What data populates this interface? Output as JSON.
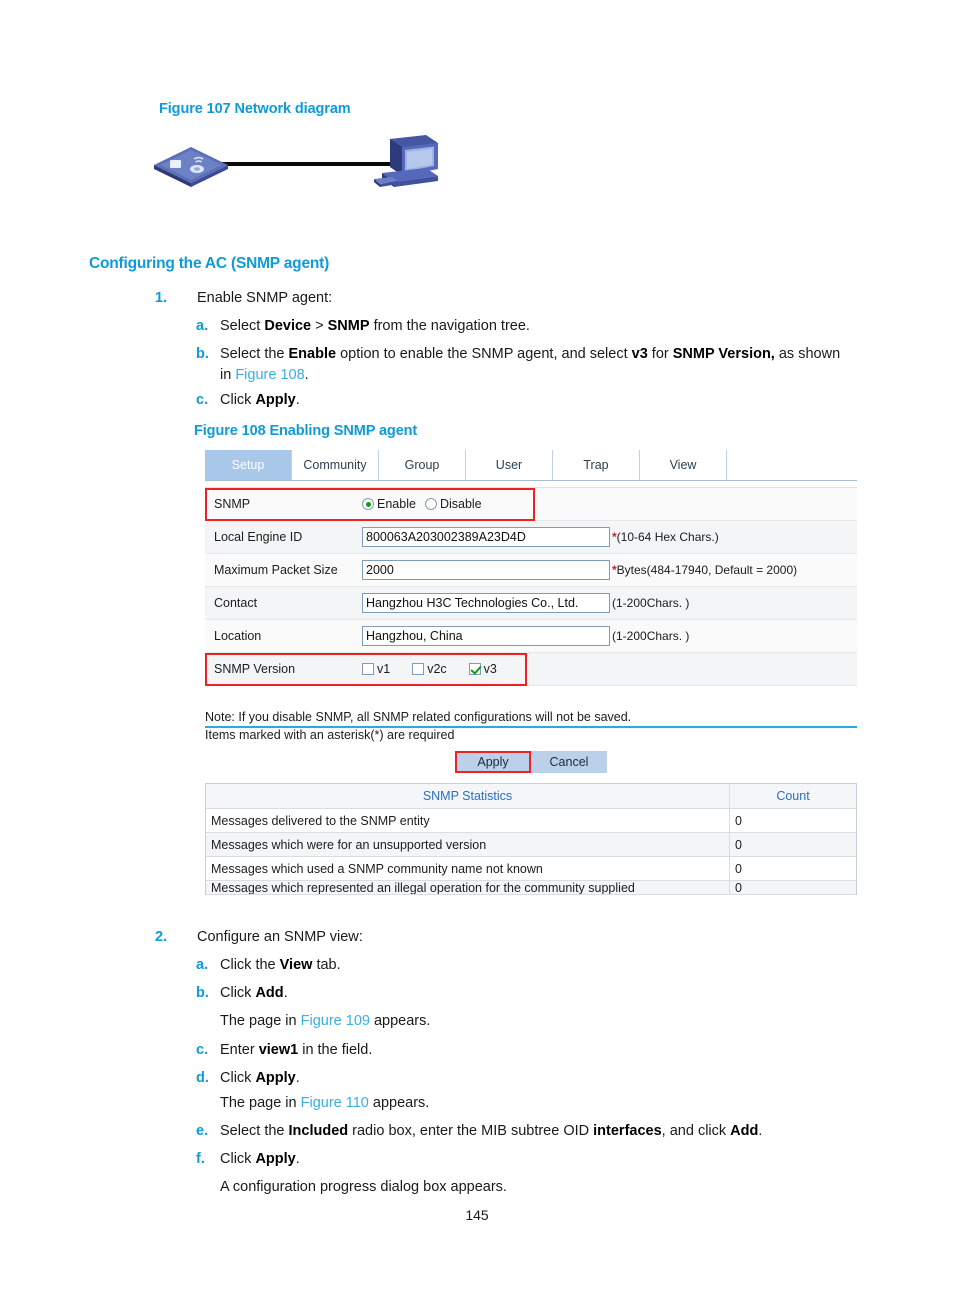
{
  "figure107": {
    "caption": "Figure 107 Network diagram",
    "devices": {
      "left": "access-controller",
      "right": "workstation-pc"
    }
  },
  "section": {
    "heading": "Configuring the AC (SNMP agent)"
  },
  "steps": [
    {
      "number": "1.",
      "text": "Enable SNMP agent:",
      "substeps": [
        {
          "marker": "a.",
          "html": "Select <b>Device</b> &gt; <b>SNMP</b> from the navigation tree."
        },
        {
          "marker": "b.",
          "html": "Select the <b>Enable</b> option to enable the SNMP agent, and select <b>v3</b> for <b>SNMP Version,</b> as shown"
        },
        {
          "marker": "b-cont",
          "html": "in <span class=\"xref\">Figure 108</span>."
        },
        {
          "marker": "c.",
          "html": "Click <b>Apply</b>."
        }
      ]
    },
    {
      "number": "2.",
      "text": "Configure an SNMP view:",
      "substeps": [
        {
          "marker": "a.",
          "html": "Click the <b>View</b> tab."
        },
        {
          "marker": "b.",
          "html": "Click <b>Add</b>."
        },
        {
          "marker": "b-note",
          "html": "The page in <span class=\"xref\">Figure 109</span> appears."
        },
        {
          "marker": "c.",
          "html": "Enter <b>view1</b> in the field."
        },
        {
          "marker": "d.",
          "html": "Click <b>Apply</b>."
        },
        {
          "marker": "d-note",
          "html": "The page in <span class=\"xref\">Figure 110</span> appears."
        },
        {
          "marker": "e.",
          "html": "Select the <b>Included</b> radio box, enter the MIB subtree OID <b>interfaces</b>, and click <b>Add</b>."
        },
        {
          "marker": "f.",
          "html": "Click <b>Apply</b>."
        },
        {
          "marker": "f-note",
          "html": "A configuration progress dialog box appears."
        }
      ]
    }
  ],
  "figure108": {
    "caption": "Figure 108 Enabling SNMP agent",
    "tabs": [
      {
        "label": "Setup",
        "active": true
      },
      {
        "label": "Community",
        "active": false
      },
      {
        "label": "Group",
        "active": false
      },
      {
        "label": "User",
        "active": false
      },
      {
        "label": "Trap",
        "active": false
      },
      {
        "label": "View",
        "active": false
      }
    ],
    "fields": {
      "snmp_label": "SNMP",
      "snmp_enable_label": "Enable",
      "snmp_disable_label": "Disable",
      "snmp_selected": "Enable",
      "engine_id_label": "Local Engine ID",
      "engine_id_value": "800063A203002389A23D4D",
      "engine_id_hint": "(10-64 Hex Chars.)",
      "packet_size_label": "Maximum Packet Size",
      "packet_size_value": "2000",
      "packet_size_hint": "Bytes(484-17940, Default = 2000)",
      "contact_label": "Contact",
      "contact_value": "Hangzhou H3C Technologies Co., Ltd.",
      "contact_hint": "(1-200Chars. )",
      "location_label": "Location",
      "location_value": "Hangzhou, China",
      "location_hint": "(1-200Chars. )",
      "version_label": "SNMP Version",
      "version_v1": "v1",
      "version_v2c": "v2c",
      "version_v3": "v3",
      "version_v1_checked": false,
      "version_v2c_checked": false,
      "version_v3_checked": true,
      "required_star": "*"
    },
    "notes": {
      "line1": "Note: If you disable SNMP, all SNMP related configurations will not be saved.",
      "line2": "Items marked with an asterisk(*) are required"
    },
    "buttons": {
      "apply": "Apply",
      "cancel": "Cancel"
    },
    "stats_table": {
      "header": {
        "name": "SNMP Statistics",
        "count": "Count"
      },
      "rows": [
        {
          "name": "Messages delivered to the SNMP entity",
          "count": "0"
        },
        {
          "name": "Messages which were for an unsupported version",
          "count": "0"
        },
        {
          "name": "Messages which used a SNMP community name not known",
          "count": "0"
        },
        {
          "name": "Messages which represented an illegal operation for the community supplied",
          "count": "0"
        }
      ]
    },
    "colors": {
      "highlight": "#ee2222",
      "active_tab": "#a9c7e8",
      "link": "#2a6fc9",
      "divider": "#29abe2"
    }
  },
  "footer": {
    "page_number": "145"
  }
}
